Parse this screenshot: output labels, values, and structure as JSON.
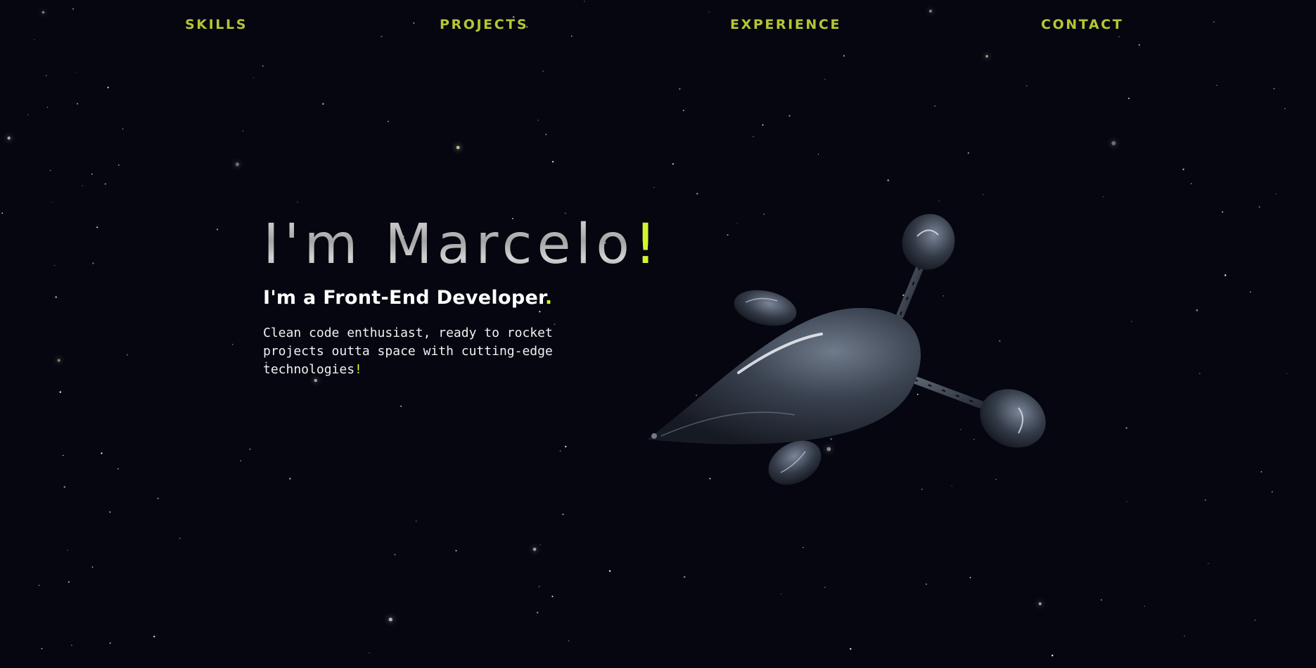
{
  "nav": {
    "items": [
      {
        "label": "SKILLS"
      },
      {
        "label": "PROJECTS"
      },
      {
        "label": "EXPERIENCE"
      },
      {
        "label": "CONTACT"
      }
    ]
  },
  "hero": {
    "title_name": "I'm Marcelo",
    "title_end": "!",
    "subtitle_start": "I'm a Front-End Developer",
    "subtitle_end": ".",
    "description": "Clean code enthusiast, ready to rocket projects outta space with cutting-edge technologies",
    "description_end": "!"
  },
  "colors": {
    "accent": "#d4f52b",
    "nav": "#b6c634",
    "background": "#05060f",
    "text": "#ffffff"
  },
  "illustration": {
    "icon": "spaceship-3d-model"
  }
}
